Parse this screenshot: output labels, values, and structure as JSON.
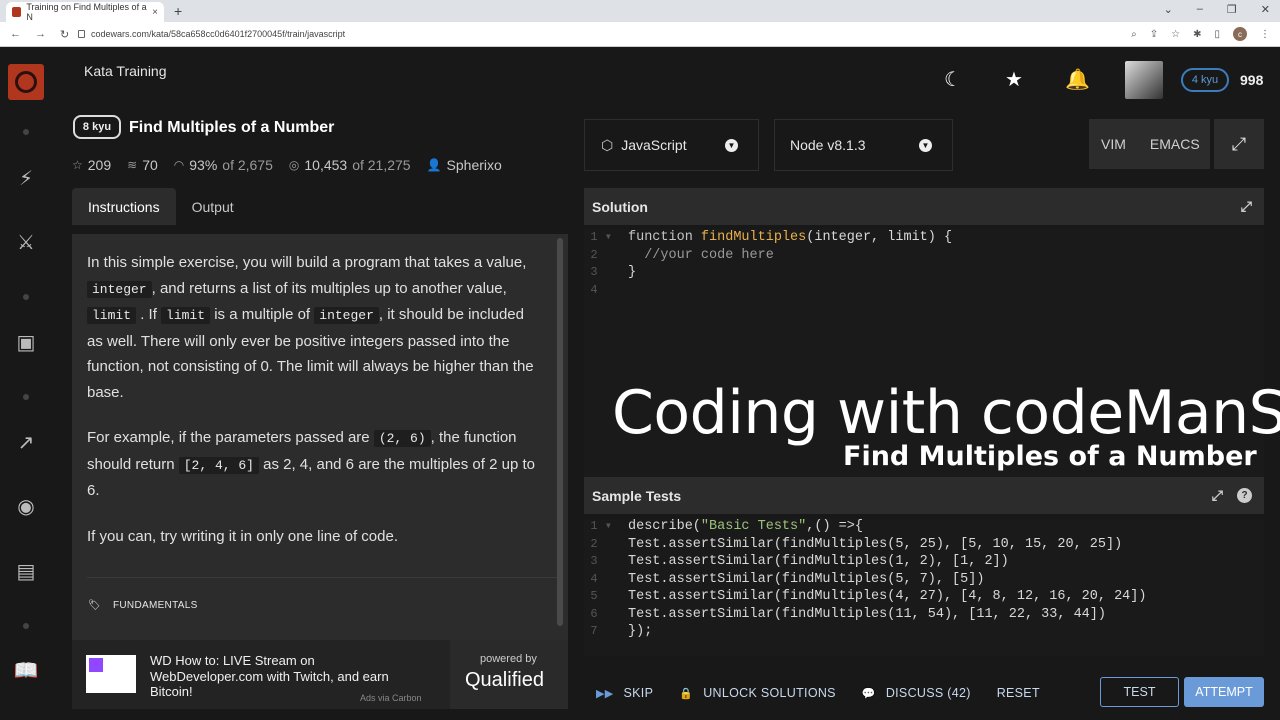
{
  "browser": {
    "tab_title": "Training on Find Multiples of a N",
    "tab_close": "×",
    "new_tab": "+",
    "url": "codewars.com/kata/58ca658cc0d6401f2700045f/train/javascript"
  },
  "header": {
    "section": "Kata Training",
    "rank": "4 kyu",
    "honor": "998"
  },
  "kata": {
    "kyu": "8 kyu",
    "title": "Find Multiples of a Number",
    "stats": {
      "stars": "209",
      "collections": "70",
      "satisfaction": "93%",
      "satisfaction_of": "of 2,675",
      "completed": "10,453",
      "completed_of": "of 21,275",
      "author": "Spherixo"
    },
    "tabs": [
      "Instructions",
      "Output"
    ],
    "description": {
      "p1_a": "In this simple exercise, you will build a program that takes a value,",
      "p1_code1": "integer",
      "p1_b": ", and returns a list of its multiples up to another value,",
      "p1_code2": "limit",
      "p1_c": ". If",
      "p1_code3": "limit",
      "p1_d": "is a multiple of",
      "p1_code4": "integer",
      "p1_e": ", it should be included as well. There will only ever be positive integers passed into the function, not consisting of 0. The limit will always be higher than the base.",
      "p2_a": "For example, if the parameters passed are",
      "p2_code1": "(2, 6)",
      "p2_b": ", the function should return",
      "p2_code2": "[2, 4, 6]",
      "p2_c": "as 2, 4, and 6 are the multiples of 2 up to 6.",
      "p3": "If you can, try writing it in only one line of code."
    },
    "tag": "FUNDAMENTALS"
  },
  "ad": {
    "text": "WD How to: LIVE Stream on WebDeveloper.com with Twitch, and earn Bitcoin!",
    "powered_by": "powered by",
    "brand": "Qualified",
    "via": "Ads via Carbon"
  },
  "editor": {
    "language": "JavaScript",
    "runtime": "Node v8.1.3",
    "modes": [
      "VIM",
      "EMACS"
    ],
    "solution_title": "Solution",
    "tests_title": "Sample Tests",
    "solution_lines": [
      {
        "n": "1",
        "fold": "▾",
        "parts": [
          [
            "kw",
            "function "
          ],
          [
            "fn",
            "findMultiples"
          ],
          [
            "code",
            "(integer, limit) {"
          ]
        ]
      },
      {
        "n": "2",
        "fold": "",
        "parts": [
          [
            "cm",
            "  //your code here"
          ]
        ]
      },
      {
        "n": "3",
        "fold": "",
        "parts": [
          [
            "code",
            "}"
          ]
        ]
      },
      {
        "n": "4",
        "fold": "",
        "parts": []
      }
    ],
    "test_lines": [
      {
        "n": "1",
        "fold": "▾",
        "parts": [
          [
            "code",
            "describe("
          ],
          [
            "str",
            "\"Basic Tests\""
          ],
          [
            "code",
            ",() =>{"
          ]
        ]
      },
      {
        "n": "2",
        "fold": "",
        "parts": [
          [
            "code",
            "Test.assertSimilar(findMultiples(5, 25), [5, 10, 15, 20, 25])"
          ]
        ]
      },
      {
        "n": "3",
        "fold": "",
        "parts": [
          [
            "code",
            "Test.assertSimilar(findMultiples(1, 2), [1, 2])"
          ]
        ]
      },
      {
        "n": "4",
        "fold": "",
        "parts": [
          [
            "code",
            "Test.assertSimilar(findMultiples(5, 7), [5])"
          ]
        ]
      },
      {
        "n": "5",
        "fold": "",
        "parts": [
          [
            "code",
            "Test.assertSimilar(findMultiples(4, 27), [4, 8, 12, 16, 20, 24])"
          ]
        ]
      },
      {
        "n": "6",
        "fold": "",
        "parts": [
          [
            "code",
            "Test.assertSimilar(findMultiples(11, 54), [11, 22, 33, 44])"
          ]
        ]
      },
      {
        "n": "7",
        "fold": "",
        "parts": [
          [
            "code",
            "});"
          ]
        ]
      }
    ]
  },
  "overlay": {
    "title": "Coding with codeManS",
    "subtitle": "Find Multiples of a Number"
  },
  "actions": {
    "skip": "SKIP",
    "unlock": "UNLOCK SOLUTIONS",
    "discuss": "DISCUSS (42)",
    "reset": "RESET",
    "test": "TEST",
    "attempt": "ATTEMPT"
  },
  "colors": {
    "brand_red": "#b1361e",
    "accent_blue": "#6a9bd8"
  }
}
